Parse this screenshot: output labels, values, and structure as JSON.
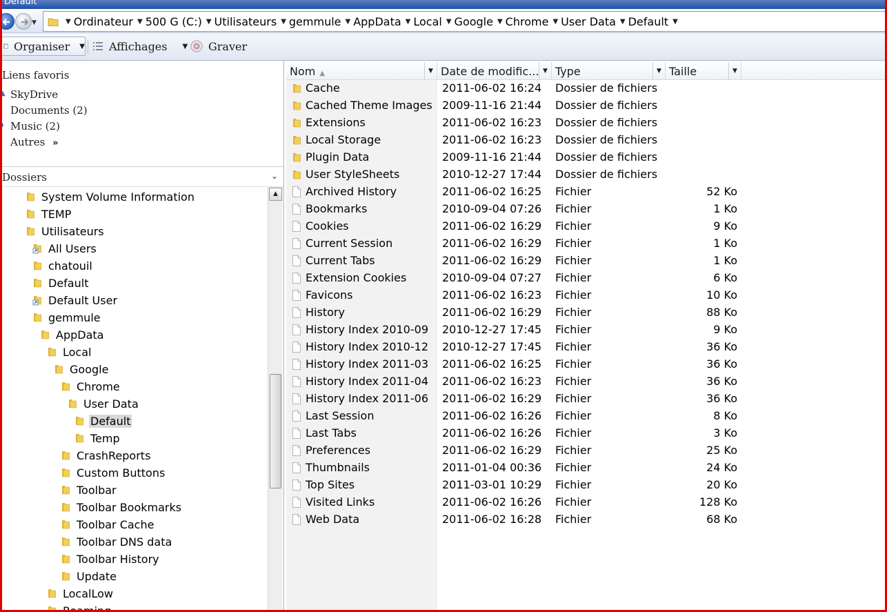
{
  "window": {
    "title": "Default"
  },
  "address": {
    "crumbs": [
      "Ordinateur",
      "500 G (C:)",
      "Utilisateurs",
      "gemmule",
      "AppData",
      "Local",
      "Google",
      "Chrome",
      "User Data",
      "Default"
    ]
  },
  "toolbar": {
    "organiser_label": "Organiser",
    "affichages_label": "Affichages",
    "graver_label": "Graver"
  },
  "favorites": {
    "title": "Liens favoris",
    "items": [
      "SkyDrive",
      "Documents (2)",
      "Music (2)",
      "Autres"
    ],
    "more_glyph": "»"
  },
  "folders_pane": {
    "label": "Dossiers"
  },
  "tree": [
    {
      "label": "System Volume Information",
      "icon": "folder-icon"
    },
    {
      "label": "TEMP",
      "icon": "folder-icon"
    },
    {
      "label": "Utilisateurs",
      "icon": "folder-icon"
    },
    {
      "label": "All Users",
      "icon": "shortcut-folder-icon"
    },
    {
      "label": "chatouil",
      "icon": "folder-icon"
    },
    {
      "label": "Default",
      "icon": "folder-icon"
    },
    {
      "label": "Default User",
      "icon": "shortcut-folder-icon"
    },
    {
      "label": "gemmule",
      "icon": "folder-icon"
    },
    {
      "label": "AppData",
      "icon": "folder-icon"
    },
    {
      "label": "Local",
      "icon": "folder-icon"
    },
    {
      "label": "Google",
      "icon": "folder-icon"
    },
    {
      "label": "Chrome",
      "icon": "folder-icon"
    },
    {
      "label": "User Data",
      "icon": "folder-icon"
    },
    {
      "label": "Default",
      "icon": "folder-icon",
      "selected": true
    },
    {
      "label": "Temp",
      "icon": "folder-icon"
    },
    {
      "label": "CrashReports",
      "icon": "folder-icon"
    },
    {
      "label": "Custom Buttons",
      "icon": "folder-icon"
    },
    {
      "label": "Toolbar",
      "icon": "folder-icon"
    },
    {
      "label": "Toolbar Bookmarks",
      "icon": "folder-icon"
    },
    {
      "label": "Toolbar Cache",
      "icon": "folder-icon"
    },
    {
      "label": "Toolbar DNS data",
      "icon": "folder-icon"
    },
    {
      "label": "Toolbar History",
      "icon": "folder-icon"
    },
    {
      "label": "Update",
      "icon": "folder-icon"
    },
    {
      "label": "LocalLow",
      "icon": "folder-icon"
    },
    {
      "label": "Roaming",
      "icon": "folder-icon"
    }
  ],
  "columns": {
    "name": "Nom",
    "date": "Date de modific...",
    "type": "Type",
    "size": "Taille"
  },
  "files": [
    {
      "name": "Cache",
      "date": "2011-06-02 16:24",
      "type": "Dossier de fichiers",
      "size": "",
      "kind": "folder"
    },
    {
      "name": "Cached Theme Images",
      "date": "2009-11-16 21:44",
      "type": "Dossier de fichiers",
      "size": "",
      "kind": "folder"
    },
    {
      "name": "Extensions",
      "date": "2011-06-02 16:23",
      "type": "Dossier de fichiers",
      "size": "",
      "kind": "folder"
    },
    {
      "name": "Local Storage",
      "date": "2011-06-02 16:23",
      "type": "Dossier de fichiers",
      "size": "",
      "kind": "folder"
    },
    {
      "name": "Plugin Data",
      "date": "2009-11-16 21:44",
      "type": "Dossier de fichiers",
      "size": "",
      "kind": "folder"
    },
    {
      "name": "User StyleSheets",
      "date": "2010-12-27 17:44",
      "type": "Dossier de fichiers",
      "size": "",
      "kind": "folder"
    },
    {
      "name": "Archived History",
      "date": "2011-06-02 16:25",
      "type": "Fichier",
      "size": "52 Ko",
      "kind": "file"
    },
    {
      "name": "Bookmarks",
      "date": "2010-09-04 07:26",
      "type": "Fichier",
      "size": "1 Ko",
      "kind": "file"
    },
    {
      "name": "Cookies",
      "date": "2011-06-02 16:29",
      "type": "Fichier",
      "size": "9 Ko",
      "kind": "file"
    },
    {
      "name": "Current Session",
      "date": "2011-06-02 16:29",
      "type": "Fichier",
      "size": "1 Ko",
      "kind": "file"
    },
    {
      "name": "Current Tabs",
      "date": "2011-06-02 16:29",
      "type": "Fichier",
      "size": "1 Ko",
      "kind": "file"
    },
    {
      "name": "Extension Cookies",
      "date": "2010-09-04 07:27",
      "type": "Fichier",
      "size": "6 Ko",
      "kind": "file"
    },
    {
      "name": "Favicons",
      "date": "2011-06-02 16:23",
      "type": "Fichier",
      "size": "10 Ko",
      "kind": "file"
    },
    {
      "name": "History",
      "date": "2011-06-02 16:29",
      "type": "Fichier",
      "size": "88 Ko",
      "kind": "file"
    },
    {
      "name": "History Index 2010-09",
      "date": "2010-12-27 17:45",
      "type": "Fichier",
      "size": "9 Ko",
      "kind": "file"
    },
    {
      "name": "History Index 2010-12",
      "date": "2010-12-27 17:45",
      "type": "Fichier",
      "size": "36 Ko",
      "kind": "file"
    },
    {
      "name": "History Index 2011-03",
      "date": "2011-06-02 16:25",
      "type": "Fichier",
      "size": "36 Ko",
      "kind": "file"
    },
    {
      "name": "History Index 2011-04",
      "date": "2011-06-02 16:23",
      "type": "Fichier",
      "size": "36 Ko",
      "kind": "file"
    },
    {
      "name": "History Index 2011-06",
      "date": "2011-06-02 16:29",
      "type": "Fichier",
      "size": "36 Ko",
      "kind": "file"
    },
    {
      "name": "Last Session",
      "date": "2011-06-02 16:26",
      "type": "Fichier",
      "size": "8 Ko",
      "kind": "file"
    },
    {
      "name": "Last Tabs",
      "date": "2011-06-02 16:26",
      "type": "Fichier",
      "size": "3 Ko",
      "kind": "file"
    },
    {
      "name": "Preferences",
      "date": "2011-06-02 16:29",
      "type": "Fichier",
      "size": "25 Ko",
      "kind": "file"
    },
    {
      "name": "Thumbnails",
      "date": "2011-01-04 00:36",
      "type": "Fichier",
      "size": "24 Ko",
      "kind": "file"
    },
    {
      "name": "Top Sites",
      "date": "2011-03-01 10:29",
      "type": "Fichier",
      "size": "20 Ko",
      "kind": "file"
    },
    {
      "name": "Visited Links",
      "date": "2011-06-02 16:26",
      "type": "Fichier",
      "size": "128 Ko",
      "kind": "file"
    },
    {
      "name": "Web Data",
      "date": "2011-06-02 16:28",
      "type": "Fichier",
      "size": "68 Ko",
      "kind": "file"
    }
  ],
  "colors": {
    "frame_border": "#e00000",
    "folder_yellow": "#f3cf56",
    "selection_gray": "#d9d9d9",
    "name_column_bg": "#f2f2f2"
  }
}
